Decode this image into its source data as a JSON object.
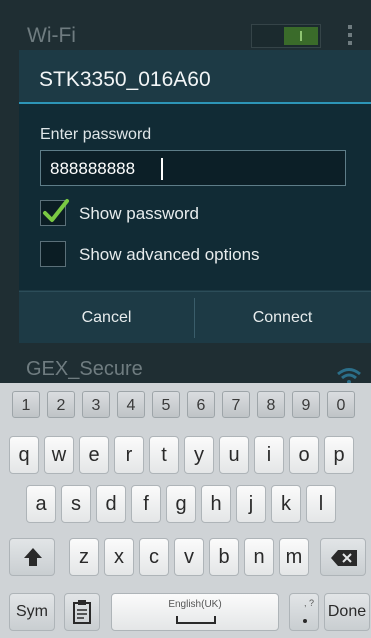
{
  "background": {
    "wifi_title": "Wi-Fi",
    "network_below": "GEX_Secure"
  },
  "dialog": {
    "title": "STK3350_016A60",
    "password_label": "Enter password",
    "password_value": "888888888",
    "show_password_label": "Show password",
    "show_password_checked": true,
    "advanced_label": "Show advanced options",
    "advanced_checked": false,
    "cancel_label": "Cancel",
    "connect_label": "Connect"
  },
  "keyboard": {
    "number_row": [
      "1",
      "2",
      "3",
      "4",
      "5",
      "6",
      "7",
      "8",
      "9",
      "0"
    ],
    "row1": [
      "q",
      "w",
      "e",
      "r",
      "t",
      "y",
      "u",
      "i",
      "o",
      "p"
    ],
    "row2": [
      "a",
      "s",
      "d",
      "f",
      "g",
      "h",
      "j",
      "k",
      "l"
    ],
    "row3": [
      "z",
      "x",
      "c",
      "v",
      "b",
      "n",
      "m"
    ],
    "sym_label": "Sym",
    "space_label": "English(UK)",
    "done_label": "Done"
  },
  "colors": {
    "accent": "#2d95b7",
    "check": "#7ac943"
  }
}
